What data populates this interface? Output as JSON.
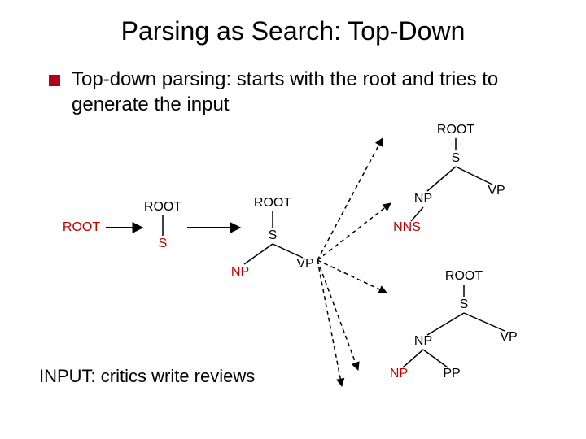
{
  "title": "Parsing as Search: Top-Down",
  "description": "Top-down parsing: starts with the root and tries to generate the input",
  "input_line": "INPUT: critics write reviews",
  "trees": {
    "t0": {
      "root": "ROOT"
    },
    "t1": {
      "root": "ROOT",
      "child": "S"
    },
    "t2": {
      "root": "ROOT",
      "s": "S",
      "np": "NP",
      "vp": "VP"
    },
    "t3": {
      "root": "ROOT",
      "s": "S",
      "np": "NP",
      "vp": "VP",
      "nns": "NNS"
    },
    "t4": {
      "root": "ROOT",
      "s": "S",
      "np": "NP",
      "vp": "VP",
      "np2": "NP",
      "pp": "PP"
    }
  }
}
